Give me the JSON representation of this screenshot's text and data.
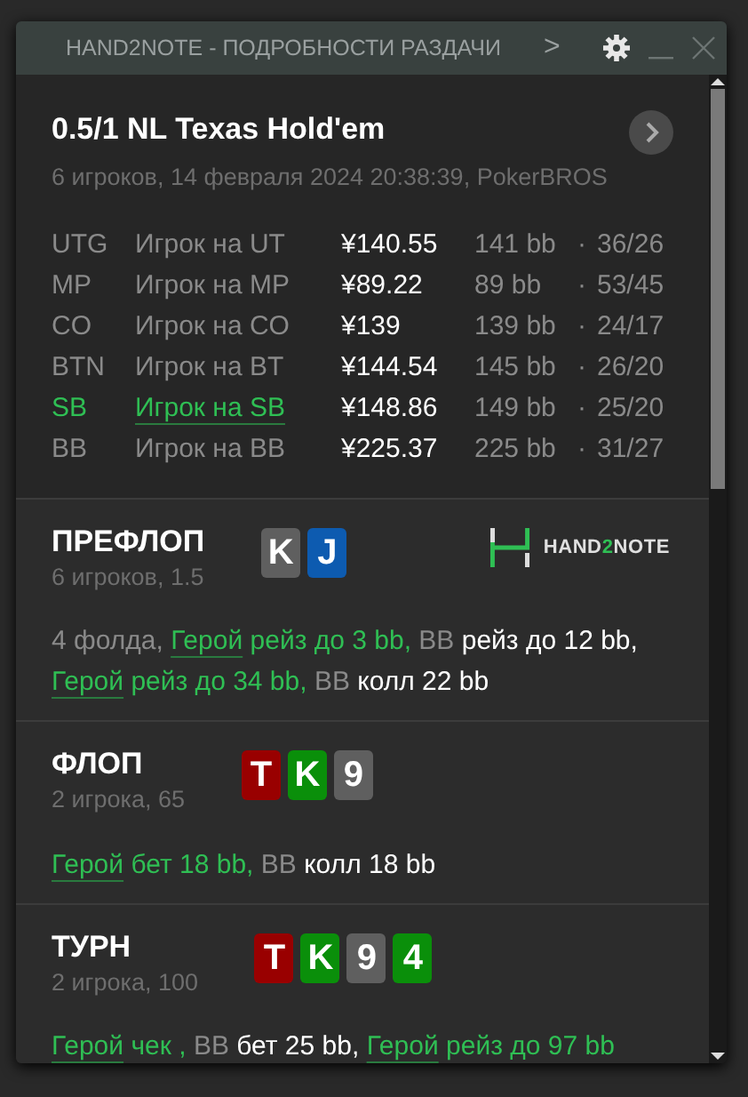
{
  "window": {
    "title": "HAND2NOTE - ПОДРОБНОСТИ РАЗДАЧИ",
    "chevron": ">"
  },
  "hand": {
    "title": "0.5/1 NL Texas Hold'em",
    "subtitle": "6 игроков, 14 февраля 2024 20:38:39, PokerBROS"
  },
  "players": [
    {
      "position": "UTG",
      "name": "Игрок на UT",
      "stack": "¥140.55",
      "bb": "141 bb",
      "sep": "·",
      "stats": "36/26",
      "hero": false
    },
    {
      "position": "MP",
      "name": "Игрок на MP",
      "stack": "¥89.22",
      "bb": "89 bb",
      "sep": "·",
      "stats": "53/45",
      "hero": false
    },
    {
      "position": "CO",
      "name": "Игрок на CO",
      "stack": "¥139",
      "bb": "139 bb",
      "sep": "·",
      "stats": "24/17",
      "hero": false
    },
    {
      "position": "BTN",
      "name": "Игрок на BT",
      "stack": "¥144.54",
      "bb": "145 bb",
      "sep": "·",
      "stats": "26/20",
      "hero": false
    },
    {
      "position": "SB",
      "name": "Игрок на SB",
      "stack": "¥148.86",
      "bb": "149 bb",
      "sep": "·",
      "stats": "25/20",
      "hero": true
    },
    {
      "position": "BB",
      "name": "Игрок на BB",
      "stack": "¥225.37",
      "bb": "225 bb",
      "sep": "·",
      "stats": "31/27",
      "hero": false
    }
  ],
  "logo": {
    "prefix": "HAND",
    "accent": "2",
    "suffix": "NOTE"
  },
  "streets": [
    {
      "title": "ПРЕФЛОП",
      "subtitle": "6 игроков, 1.5",
      "logo": true,
      "cards": [
        {
          "rank": "K",
          "color": "#5f5f5f"
        },
        {
          "rank": "J",
          "color": "#0d5bb0"
        }
      ],
      "actions": [
        {
          "kind": "muted",
          "text": "4 фолда,"
        },
        {
          "kind": "hero-name",
          "text": "Герой"
        },
        {
          "kind": "hero-action",
          "text": "рейз до 3 bb,"
        },
        {
          "kind": "name",
          "text": "BB"
        },
        {
          "kind": "action",
          "text": "рейз до 12 bb,"
        },
        {
          "kind": "hero-name",
          "text": "Герой"
        },
        {
          "kind": "hero-action",
          "text": "рейз до 34 bb,"
        },
        {
          "kind": "name",
          "text": "BB"
        },
        {
          "kind": "action",
          "text": "колл 22 bb"
        }
      ]
    },
    {
      "title": "ФЛОП",
      "subtitle": "2 игрока, 65",
      "cards": [
        {
          "rank": "T",
          "color": "#990000"
        },
        {
          "rank": "K",
          "color": "#0a8f0a"
        },
        {
          "rank": "9",
          "color": "#5f5f5f"
        }
      ],
      "actions": [
        {
          "kind": "hero-name",
          "text": "Герой"
        },
        {
          "kind": "hero-action",
          "text": "бет 18 bb,"
        },
        {
          "kind": "name",
          "text": "BB"
        },
        {
          "kind": "action",
          "text": "колл 18 bb"
        }
      ]
    },
    {
      "title": "ТУРН",
      "subtitle": "2 игрока, 100",
      "cards": [
        {
          "rank": "T",
          "color": "#990000"
        },
        {
          "rank": "K",
          "color": "#0a8f0a"
        },
        {
          "rank": "9",
          "color": "#5f5f5f"
        },
        {
          "rank": "4",
          "color": "#0a8f0a"
        }
      ],
      "actions": [
        {
          "kind": "hero-name",
          "text": "Герой"
        },
        {
          "kind": "hero-action",
          "text": "чек ,"
        },
        {
          "kind": "name",
          "text": "BB"
        },
        {
          "kind": "action",
          "text": "бет 25 bb,"
        },
        {
          "kind": "hero-name",
          "text": "Герой"
        },
        {
          "kind": "hero-action",
          "text": "рейз до 97 bb"
        }
      ]
    }
  ]
}
